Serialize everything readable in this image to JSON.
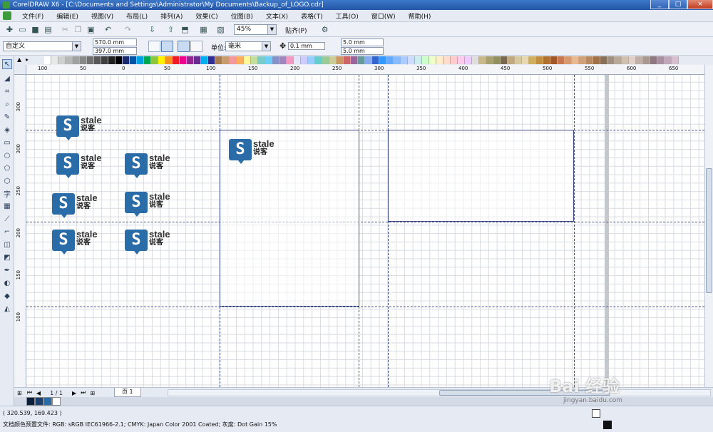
{
  "window": {
    "title": "CorelDRAW X6 - [C:\\Documents and Settings\\Administrator\\My Documents\\Backup_of_LOGO.cdr]",
    "controls": [
      "_",
      "□",
      "×"
    ]
  },
  "menu": [
    "文件(F)",
    "编辑(E)",
    "视图(V)",
    "布局(L)",
    "排列(A)",
    "效果(C)",
    "位图(B)",
    "文本(X)",
    "表格(T)",
    "工具(O)",
    "窗口(W)",
    "帮助(H)"
  ],
  "toolbar": {
    "zoom": "45%",
    "snap": "贴齐(P)"
  },
  "property_bar": {
    "preset": "自定义",
    "width": "570.0 mm",
    "height": "397.0 mm",
    "unit_label": "单位:",
    "unit": "毫米",
    "nudge": "0.1 mm",
    "dup_x": "5.0 mm",
    "dup_y": "5.0 mm"
  },
  "palette_colors": [
    "#ffffff",
    "#e8e8e8",
    "#d0d0d0",
    "#b8b8b8",
    "#a0a0a0",
    "#888888",
    "#707070",
    "#585858",
    "#404040",
    "#202020",
    "#000000",
    "#1a2a6c",
    "#0055a5",
    "#00a0e0",
    "#00a651",
    "#8dc63f",
    "#fff200",
    "#f7941d",
    "#ed1c24",
    "#ec008c",
    "#92278f",
    "#662d91",
    "#00aeef",
    "#2e3192",
    "#a67c52",
    "#c69c6d",
    "#f5989d",
    "#fbaf5d",
    "#fff799",
    "#c4df9b",
    "#7accc8",
    "#6dcff6",
    "#8393ca",
    "#a186be",
    "#f49ac1",
    "#e6e6fa",
    "#ccccff",
    "#99ccff",
    "#66cccc",
    "#99cc99",
    "#cccc99",
    "#cc9966",
    "#cc6666",
    "#996699",
    "#669999",
    "#88aaee",
    "#3366cc",
    "#3399ff",
    "#66aaff",
    "#88bbff",
    "#aaccff",
    "#ccddff",
    "#cceeee",
    "#ccffcc",
    "#eeffcc",
    "#ffeecc",
    "#ffddcc",
    "#ffcccc",
    "#ffccee",
    "#eeccff",
    "#dddddd",
    "#c8b88a",
    "#a8a070",
    "#909060",
    "#786850",
    "#c0a880",
    "#d8c8a0",
    "#e8d8b0",
    "#d0b060",
    "#c09040",
    "#b07030",
    "#a05828",
    "#c87850",
    "#d89870",
    "#e8b890",
    "#d0a078",
    "#b88860",
    "#a07048",
    "#887058",
    "#a09080",
    "#b8a898",
    "#d0c0b0",
    "#e0d0c8",
    "#c0b0a8",
    "#a89890",
    "#907880",
    "#a890a0",
    "#c0a8b8",
    "#d8c0d0"
  ],
  "ruler": {
    "h_ticks": [
      "100",
      "50",
      "0",
      "50",
      "100",
      "150",
      "200",
      "250",
      "300",
      "350",
      "400",
      "450",
      "500",
      "550",
      "600",
      "650"
    ],
    "v_ticks": [
      "300",
      "300",
      "250",
      "200",
      "150",
      "100"
    ]
  },
  "logos": [
    {
      "word": "stale",
      "cn": "说客"
    },
    {
      "word": "stale",
      "cn": "说客"
    },
    {
      "word": "stale",
      "cn": "说客"
    },
    {
      "word": "stale",
      "cn": "说客"
    },
    {
      "word": "stale",
      "cn": "说客"
    },
    {
      "word": "stale",
      "cn": "说客"
    },
    {
      "word": "stale",
      "cn": "说客"
    },
    {
      "word": "stale",
      "cn": "说客"
    }
  ],
  "page_nav": {
    "counter": "1 / 1",
    "tab": "页 1"
  },
  "status": {
    "coords": "( 320.539, 169.423 )",
    "profile": "文档颜色预置文件: RGB: sRGB IEC61966-2.1; CMYK: Japan Color 2001 Coated; 灰度: Dot Gain 15%"
  },
  "watermark": {
    "brand": "Bai 经验",
    "url": "jingyan.baidu.com"
  }
}
